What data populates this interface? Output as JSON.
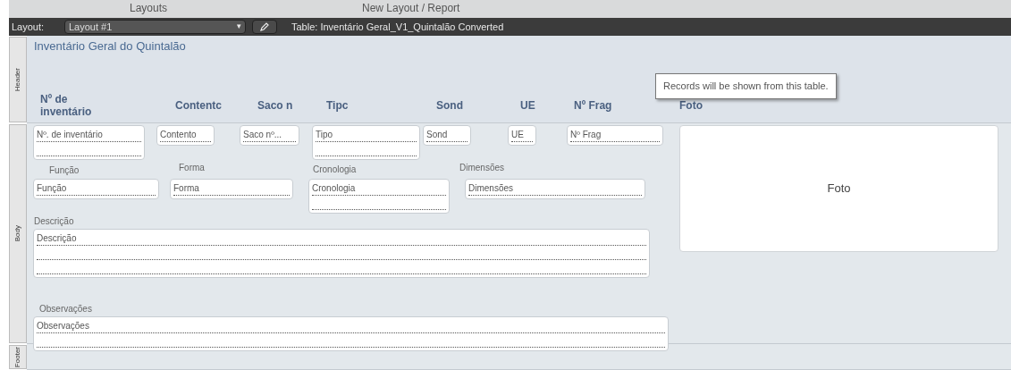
{
  "top_tabs": [
    "Layouts",
    "New Layout / Report"
  ],
  "layout_bar": {
    "label": "Layout:",
    "layout_name": "Layout #1",
    "dropdown_caret": "▾",
    "table": "Table: Inventário Geral_V1_Quintalão Converted"
  },
  "parts": [
    "Header",
    "Body",
    "Footer"
  ],
  "header": {
    "title": "Inventário Geral do Quintalão",
    "column_labels": [
      "Nº de inventário",
      "Contentc",
      "Saco n",
      "Tipc",
      "Sond",
      "UE",
      "Nº Frag",
      "Foto"
    ]
  },
  "tooltip": "Records will be shown from this table.",
  "body": {
    "fields": [
      "Nº. de inventário",
      "Contento",
      "Saco nº...",
      "Tipo",
      "Sond",
      "UE",
      "Nº Frag",
      "Função",
      "Forma",
      "Cronologia",
      "Dimensões",
      "Descrição",
      "Observações"
    ],
    "labels": [
      "Função",
      "Forma",
      "Cronologia",
      "Dimensões",
      "Descrição",
      "Observações"
    ],
    "photo": "Foto"
  }
}
